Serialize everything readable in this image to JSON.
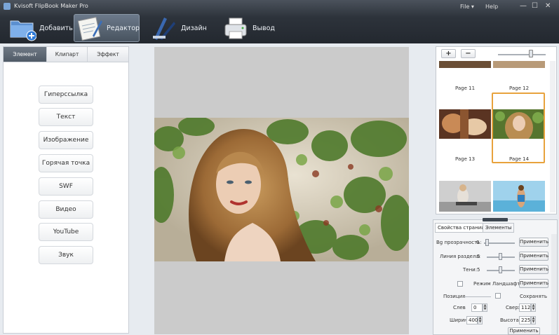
{
  "window": {
    "title": "Kvisoft FlipBook Maker Pro",
    "menu_file": "File ▾",
    "menu_help": "Help",
    "ctl_min": "—",
    "ctl_max": "☐",
    "ctl_close": "✕"
  },
  "toolbar": [
    {
      "label": "Добавить",
      "icon": "add-folder-icon"
    },
    {
      "label": "Редактор",
      "icon": "editor-notepad-icon"
    },
    {
      "label": "Дизайн",
      "icon": "design-tools-icon"
    },
    {
      "label": "Вывод",
      "icon": "output-printer-icon"
    }
  ],
  "left_panel": {
    "tabs": [
      "Элемент",
      "Клипарт",
      "Эффект"
    ],
    "buttons": [
      "Гиперссылка",
      "Текст",
      "Изображение",
      "Горячая точка",
      "SWF",
      "Видео",
      "YouTube",
      "Звук"
    ]
  },
  "thumbs": {
    "zoom_in": "+",
    "zoom_out": "−",
    "pages": [
      "Page 11",
      "Page 12",
      "Page 13",
      "Page 14"
    ]
  },
  "props": {
    "tabs": [
      "Свойства страницы",
      "Элементы"
    ],
    "rows": [
      {
        "label": "Вg прозрачность:",
        "value": "0",
        "button": "Применить"
      },
      {
        "label": "Линия раздела:",
        "value": "5",
        "button": "Применить"
      },
      {
        "label": "Тени:",
        "value": "5",
        "button": "Применить"
      },
      {
        "label": "Режим Ландшафт",
        "button": "Применить"
      }
    ],
    "position_label": "Позиция",
    "save_label": "Сохранять",
    "left_label": "Слев",
    "left_value": "0",
    "top_label": "Сверх",
    "top_value": "112",
    "width_label": "Ширин",
    "width_value": "400",
    "height_label": "Высота",
    "height_value": "225",
    "bottom_button": "Применить"
  },
  "colors": {
    "accent_selected": "#e8a23c",
    "toolbar_bg": "#2d333b",
    "active_tab": "#505a66"
  }
}
